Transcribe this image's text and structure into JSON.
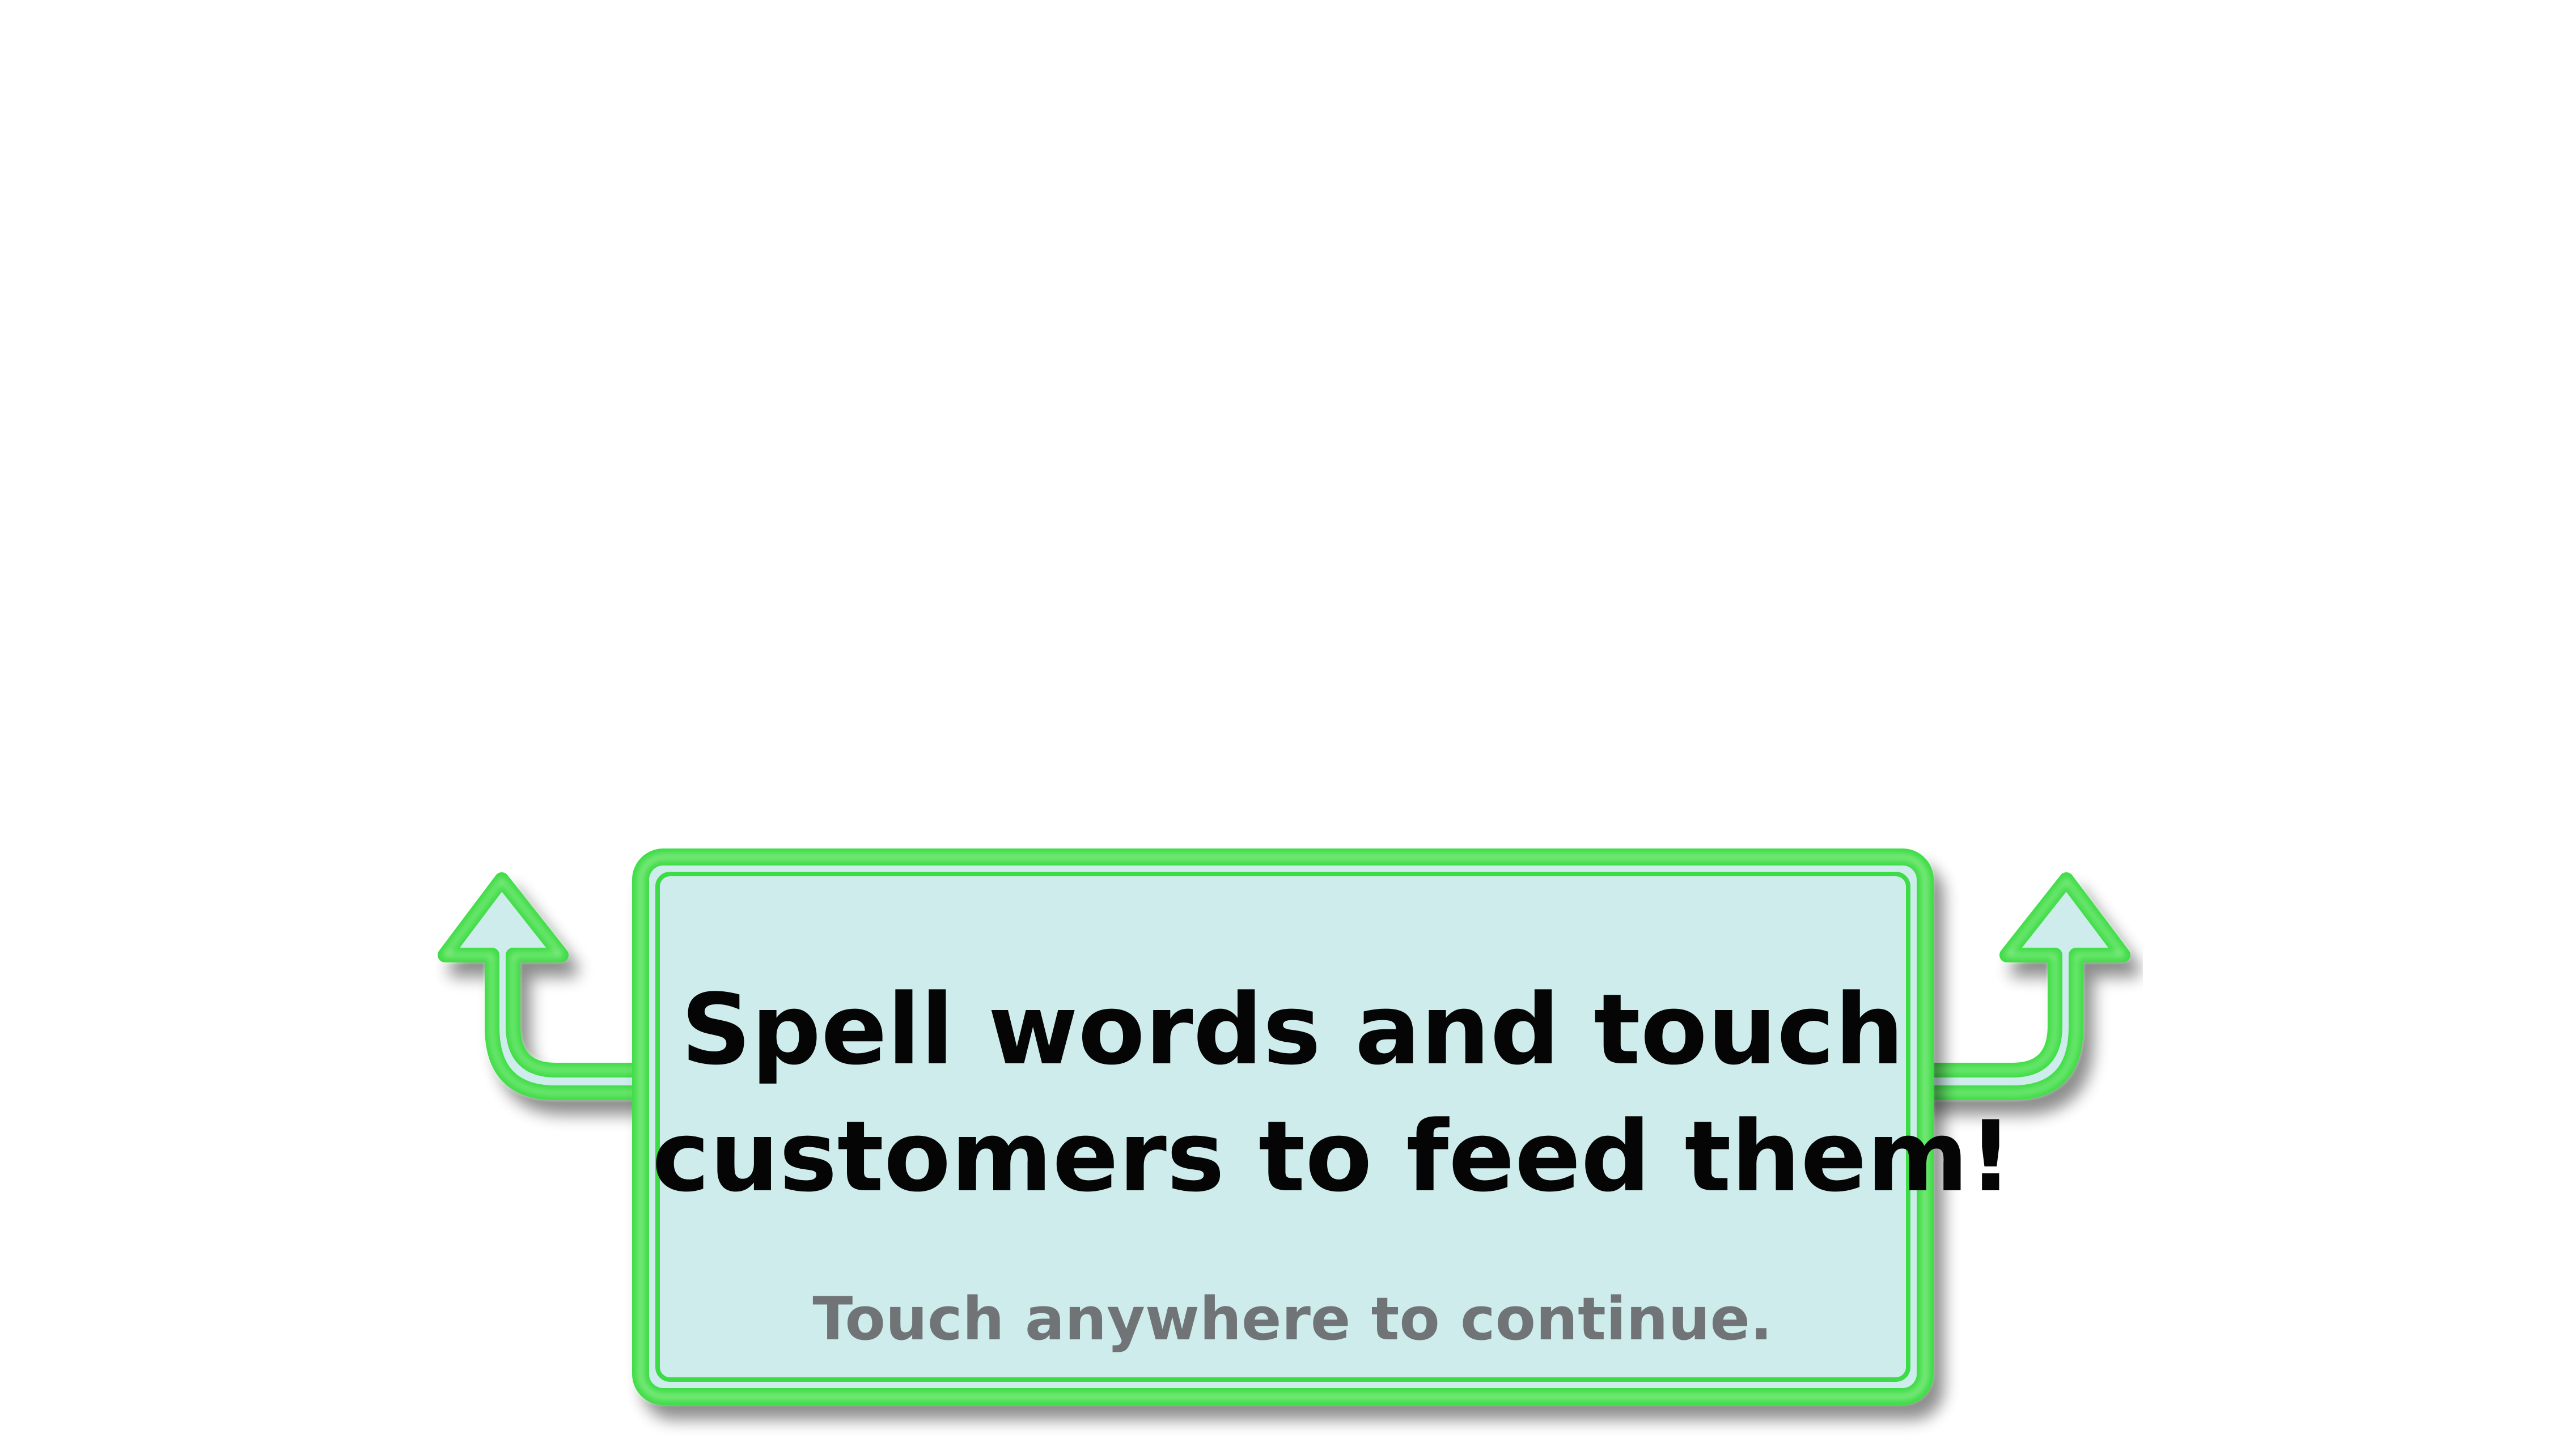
{
  "tutorial": {
    "message_line1": "Spell words and touch",
    "message_line2": "customers to feed them!",
    "continue_hint": "Touch anywhere to continue."
  },
  "colors": {
    "background": "#ffffff",
    "panel_fill": "#ceecec",
    "panel_border": "#3edc46",
    "panel_border_light": "#9ff19c",
    "message_text": "#050505",
    "hint_text": "#707476"
  },
  "icons": {
    "left_arrow": "arrow-up-left-icon",
    "right_arrow": "arrow-up-right-icon"
  }
}
